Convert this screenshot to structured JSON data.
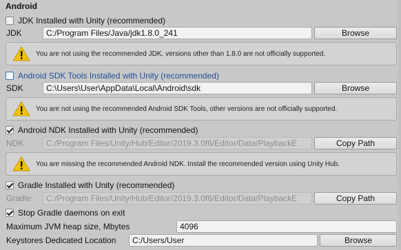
{
  "section_title": "Android",
  "jdk": {
    "checkbox_label": "JDK Installed with Unity (recommended)",
    "checked": false,
    "field_label": "JDK",
    "path": "C:/Program Files/Java/jdk1.8.0_241",
    "button": "Browse",
    "warning": "You are not using the recommended JDK, versions other than 1.8.0 are not officially supported."
  },
  "sdk": {
    "checkbox_label": "Android SDK Tools Installed with Unity (recommended)",
    "checked": false,
    "field_label": "SDK",
    "path": "C:\\Users\\User\\AppData\\Local\\Android\\sdk",
    "button": "Browse",
    "warning": "You are not using the recommended Android SDK Tools, other versions are not officially supported."
  },
  "ndk": {
    "checkbox_label": "Android NDK Installed with Unity (recommended)",
    "checked": true,
    "field_label": "NDK",
    "path": "C:/Program Files/Unity/Hub/Editor/2019.3.0f6/Editor/Data/PlaybackE",
    "button": "Copy Path",
    "warning": "You are missing the recommended Android NDK. Install the recommended version using Unity Hub."
  },
  "gradle": {
    "checkbox_label": "Gradle Installed with Unity (recommended)",
    "checked": true,
    "field_label": "Gradle",
    "path": "C:/Program Files/Unity/Hub/Editor/2019.3.0f6/Editor/Data/PlaybackE",
    "button": "Copy Path"
  },
  "stop_gradle": {
    "checkbox_label": "Stop Gradle daemons on exit",
    "checked": true
  },
  "jvm_heap": {
    "label": "Maximum JVM heap size, Mbytes",
    "value": "4096"
  },
  "keystores": {
    "label": "Keystores Dedicated Location",
    "path": "C:/Users/User",
    "button": "Browse"
  },
  "colors": {
    "panel_bg": "#c8c8c8",
    "focus_blue": "#1d4f96",
    "warning_yellow": "#f2c200"
  }
}
